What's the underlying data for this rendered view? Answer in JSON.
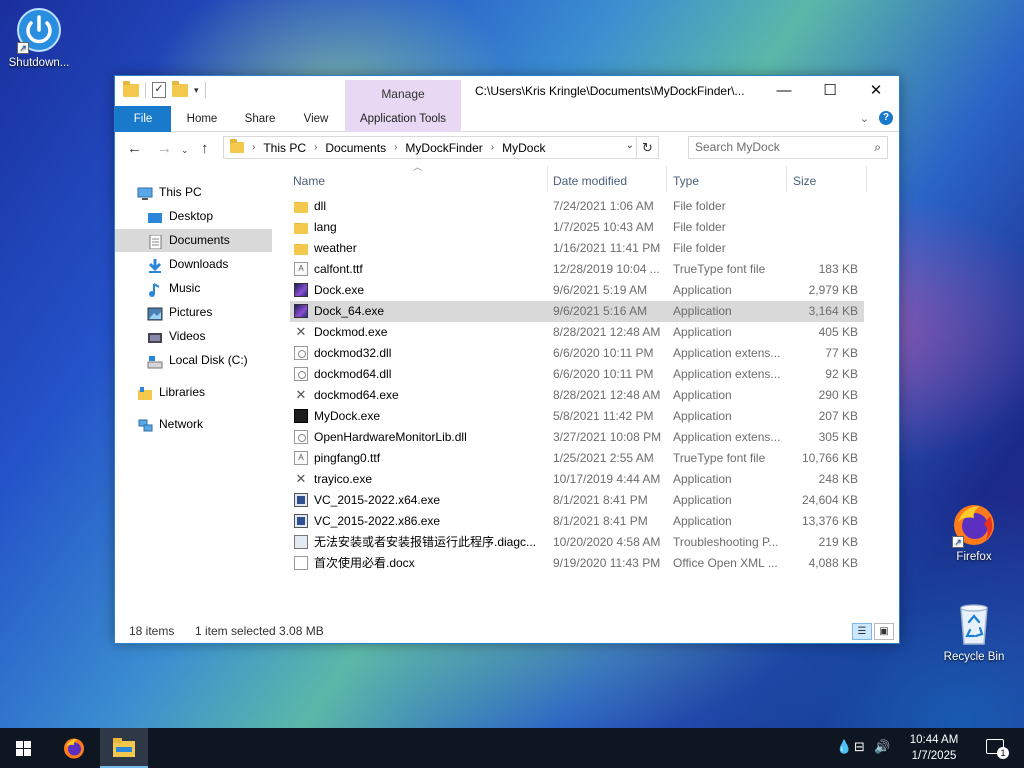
{
  "desktop": {
    "icons": [
      {
        "label": "Shutdown...",
        "icon": "power-icon"
      },
      {
        "label": "Firefox",
        "icon": "firefox-icon"
      },
      {
        "label": "Recycle Bin",
        "icon": "recycle-bin-icon"
      }
    ]
  },
  "window": {
    "title_path": "C:\\Users\\Kris Kringle\\Documents\\MyDockFinder\\...",
    "manage_label": "Manage",
    "controls": {
      "minimize": "—",
      "maximize": "☐",
      "close": "✕"
    },
    "ribbon_tabs": [
      "File",
      "Home",
      "Share",
      "View",
      "Application Tools"
    ],
    "address": {
      "breadcrumbs": [
        "This PC",
        "Documents",
        "MyDockFinder",
        "MyDock"
      ]
    },
    "search": {
      "placeholder": "Search MyDock"
    },
    "nav_pane": [
      {
        "label": "This PC",
        "icon": "monitor-icon"
      },
      {
        "label": "Desktop",
        "icon": "desktop-icon"
      },
      {
        "label": "Documents",
        "icon": "documents-icon",
        "selected": true
      },
      {
        "label": "Downloads",
        "icon": "download-icon"
      },
      {
        "label": "Music",
        "icon": "music-icon"
      },
      {
        "label": "Pictures",
        "icon": "pictures-icon"
      },
      {
        "label": "Videos",
        "icon": "videos-icon"
      },
      {
        "label": "Local Disk (C:)",
        "icon": "disk-icon"
      },
      {
        "label": "Libraries",
        "icon": "libraries-icon"
      },
      {
        "label": "Network",
        "icon": "network-icon"
      }
    ],
    "columns": [
      "Name",
      "Date modified",
      "Type",
      "Size"
    ],
    "files": [
      {
        "name": "dll",
        "date": "7/24/2021 1:06 AM",
        "type": "File folder",
        "size": "",
        "icon": "folder"
      },
      {
        "name": "lang",
        "date": "1/7/2025 10:43 AM",
        "type": "File folder",
        "size": "",
        "icon": "folder"
      },
      {
        "name": "weather",
        "date": "1/16/2021 11:41 PM",
        "type": "File folder",
        "size": "",
        "icon": "folder"
      },
      {
        "name": "calfont.ttf",
        "date": "12/28/2019 10:04 ...",
        "type": "TrueType font file",
        "size": "183 KB",
        "icon": "font"
      },
      {
        "name": "Dock.exe",
        "date": "9/6/2021 5:19 AM",
        "type": "Application",
        "size": "2,979 KB",
        "icon": "dock"
      },
      {
        "name": "Dock_64.exe",
        "date": "9/6/2021 5:16 AM",
        "type": "Application",
        "size": "3,164 KB",
        "icon": "dock",
        "selected": true
      },
      {
        "name": "Dockmod.exe",
        "date": "8/28/2021 12:48 AM",
        "type": "Application",
        "size": "405 KB",
        "icon": "mod"
      },
      {
        "name": "dockmod32.dll",
        "date": "6/6/2020 10:11 PM",
        "type": "Application extens...",
        "size": "77 KB",
        "icon": "dll"
      },
      {
        "name": "dockmod64.dll",
        "date": "6/6/2020 10:11 PM",
        "type": "Application extens...",
        "size": "92 KB",
        "icon": "dll"
      },
      {
        "name": "dockmod64.exe",
        "date": "8/28/2021 12:48 AM",
        "type": "Application",
        "size": "290 KB",
        "icon": "mod"
      },
      {
        "name": "MyDock.exe",
        "date": "5/8/2021 11:42 PM",
        "type": "Application",
        "size": "207 KB",
        "icon": "black"
      },
      {
        "name": "OpenHardwareMonitorLib.dll",
        "date": "3/27/2021 10:08 PM",
        "type": "Application extens...",
        "size": "305 KB",
        "icon": "dll"
      },
      {
        "name": "pingfang0.ttf",
        "date": "1/25/2021 2:55 AM",
        "type": "TrueType font file",
        "size": "10,766 KB",
        "icon": "font"
      },
      {
        "name": "trayico.exe",
        "date": "10/17/2019 4:44 AM",
        "type": "Application",
        "size": "248 KB",
        "icon": "mod"
      },
      {
        "name": "VC_2015-2022.x64.exe",
        "date": "8/1/2021 8:41 PM",
        "type": "Application",
        "size": "24,604 KB",
        "icon": "setup"
      },
      {
        "name": "VC_2015-2022.x86.exe",
        "date": "8/1/2021 8:41 PM",
        "type": "Application",
        "size": "13,376 KB",
        "icon": "setup"
      },
      {
        "name": "无法安装或者安装报错运行此程序.diagc...",
        "date": "10/20/2020 4:58 AM",
        "type": "Troubleshooting P...",
        "size": "219 KB",
        "icon": "diag"
      },
      {
        "name": "首次使用必看.docx",
        "date": "9/19/2020 11:43 PM",
        "type": "Office Open XML ...",
        "size": "4,088 KB",
        "icon": "docx"
      }
    ],
    "status": {
      "item_count": "18 items",
      "selection": "1 item selected  3.08 MB"
    }
  },
  "taskbar": {
    "apps": [
      {
        "name": "firefox-icon"
      },
      {
        "name": "file-explorer-icon",
        "active": true
      }
    ],
    "clock": {
      "time": "10:44 AM",
      "date": "1/7/2025"
    },
    "notification_count": "1"
  }
}
